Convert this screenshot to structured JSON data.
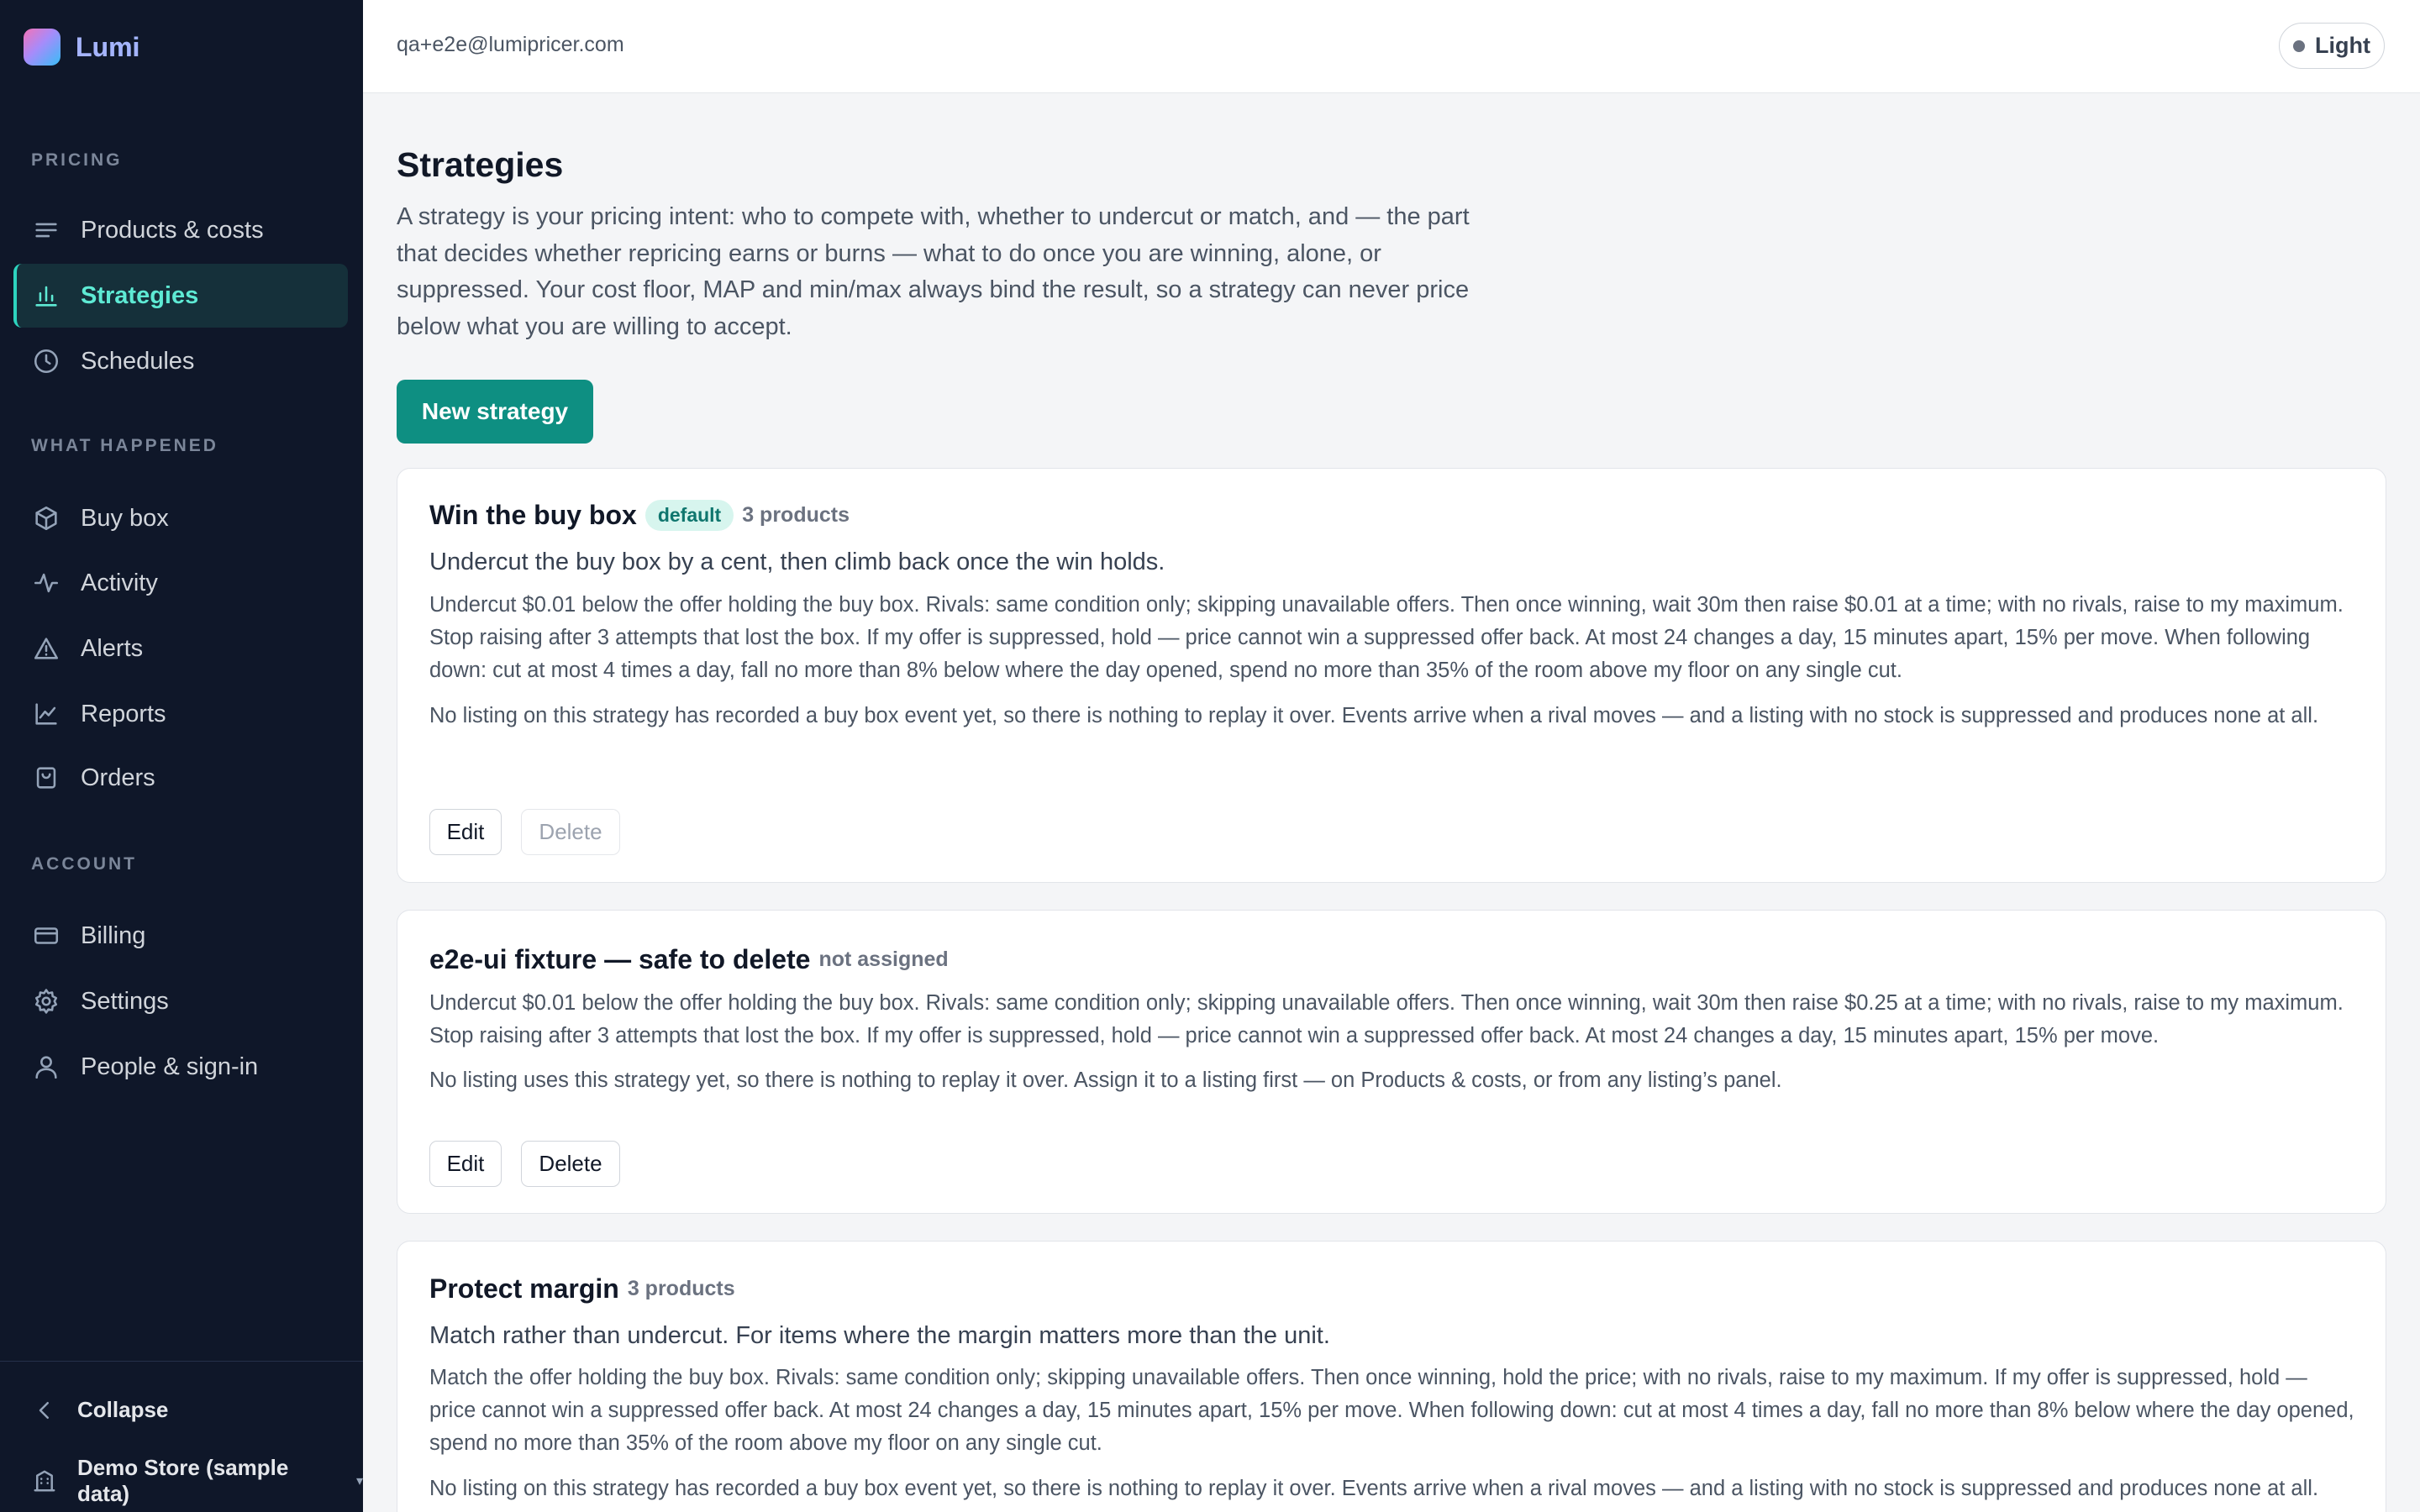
{
  "app": {
    "name": "Lumi"
  },
  "sidebar": {
    "sections": {
      "pricing": "PRICING",
      "what_happened": "WHAT HAPPENED",
      "account": "ACCOUNT"
    },
    "items": [
      {
        "label": "Products & costs",
        "icon": "list-icon"
      },
      {
        "label": "Strategies",
        "icon": "bar-chart-icon",
        "active": true
      },
      {
        "label": "Schedules",
        "icon": "clock-icon"
      },
      {
        "label": "Buy box",
        "icon": "box-icon"
      },
      {
        "label": "Activity",
        "icon": "activity-icon"
      },
      {
        "label": "Alerts",
        "icon": "alert-triangle-icon"
      },
      {
        "label": "Reports",
        "icon": "line-chart-icon"
      },
      {
        "label": "Orders",
        "icon": "shopping-bag-icon"
      },
      {
        "label": "Billing",
        "icon": "credit-card-icon"
      },
      {
        "label": "Settings",
        "icon": "gear-icon"
      },
      {
        "label": "People & sign-in",
        "icon": "user-icon"
      }
    ],
    "collapse_label": "Collapse",
    "store_label": "Demo Store (sample data)"
  },
  "topbar": {
    "email": "qa+e2e@lumipricer.com",
    "theme_label": "Light"
  },
  "page": {
    "title": "Strategies",
    "intro": "A strategy is your pricing intent: who to compete with, whether to undercut or match, and — the part that decides whether repricing earns or burns — what to do once you are winning, alone, or suppressed. Your cost floor, MAP and min/max always bind the result, so a strategy can never price below what you are willing to accept.",
    "new_button": "New strategy"
  },
  "strategies": [
    {
      "title": "Win the buy box",
      "badge": "default",
      "meta": "3 products",
      "subtitle": "Undercut the buy box by a cent, then climb back once the win holds.",
      "rules": "Undercut $0.01 below the offer holding the buy box. Rivals: same condition only; skipping unavailable offers. Then once winning, wait 30m then raise $0.01 at a time; with no rivals, raise to my maximum. Stop raising after 3 attempts that lost the box. If my offer is suppressed, hold — price cannot win a suppressed offer back. At most 24 changes a day, 15 minutes apart, 15% per move. When following down: cut at most 4 times a day, fall no more than 8% below where the day opened, spend no more than 35% of the room above my floor on any single cut.",
      "note": "No listing on this strategy has recorded a buy box event yet, so there is nothing to replay it over. Events arrive when a rival moves — and a listing with no stock is suppressed and produces none at all.",
      "edit_label": "Edit",
      "delete_label": "Delete",
      "delete_disabled": true
    },
    {
      "title": "e2e-ui fixture — safe to delete",
      "meta": "not assigned",
      "rules": "Undercut $0.01 below the offer holding the buy box. Rivals: same condition only; skipping unavailable offers. Then once winning, wait 30m then raise $0.25 at a time; with no rivals, raise to my maximum. Stop raising after 3 attempts that lost the box. If my offer is suppressed, hold — price cannot win a suppressed offer back. At most 24 changes a day, 15 minutes apart, 15% per move.",
      "note": "No listing uses this strategy yet, so there is nothing to replay it over. Assign it to a listing first — on Products & costs, or from any listing’s panel.",
      "edit_label": "Edit",
      "delete_label": "Delete",
      "delete_disabled": false
    },
    {
      "title": "Protect margin",
      "meta": "3 products",
      "subtitle": "Match rather than undercut. For items where the margin matters more than the unit.",
      "rules": "Match the offer holding the buy box. Rivals: same condition only; skipping unavailable offers. Then once winning, hold the price; with no rivals, raise to my maximum. If my offer is suppressed, hold — price cannot win a suppressed offer back. At most 24 changes a day, 15 minutes apart, 15% per move. When following down: cut at most 4 times a day, fall no more than 8% below where the day opened, spend no more than 35% of the room above my floor on any single cut.",
      "note": "No listing on this strategy has recorded a buy box event yet, so there is nothing to replay it over. Events arrive when a rival moves — and a listing with no stock is suppressed and produces none at all."
    }
  ],
  "colors": {
    "sidebar_bg": "#0f1729",
    "accent": "#0e8f82",
    "active_text": "#5eead4"
  }
}
